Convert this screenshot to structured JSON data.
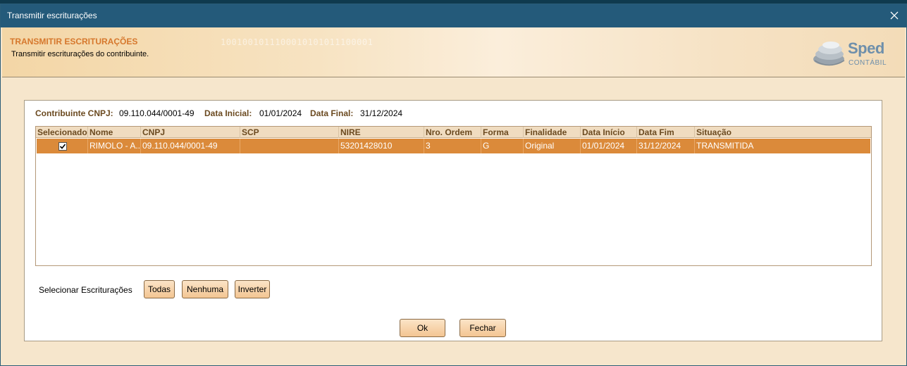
{
  "window": {
    "title": "Transmitir escriturações"
  },
  "banner": {
    "heading": "TRANSMITIR ESCRITURAÇÕES",
    "subheading": "Transmitir escriturações do contribuinte.",
    "binary_text": "1001001011100010101011100001",
    "logo": {
      "name": "Sped",
      "sub": "CONTÁBIL"
    }
  },
  "info": {
    "cnpj_label": "Contribuinte CNPJ:",
    "cnpj_value": "09.110.044/0001-49",
    "data_inicial_label": "Data Inicial:",
    "data_inicial_value": "01/01/2024",
    "data_final_label": "Data Final:",
    "data_final_value": "31/12/2024"
  },
  "table": {
    "columns": [
      "Selecionado",
      "Nome",
      "CNPJ",
      "SCP",
      "NIRE",
      "Nro. Ordem",
      "Forma",
      "Finalidade",
      "Data Início",
      "Data Fim",
      "Situação"
    ],
    "rows": [
      {
        "selected": true,
        "nome": "RIMOLO - A...",
        "cnpj": "09.110.044/0001-49",
        "scp": "",
        "nire": "53201428010",
        "nro_ordem": "3",
        "forma": "G",
        "finalidade": "Original",
        "data_inicio": "01/01/2024",
        "data_fim": "31/12/2024",
        "situacao": "TRANSMITIDA"
      }
    ]
  },
  "selection": {
    "label": "Selecionar Escriturações",
    "todas": "Todas",
    "nenhuma": "Nenhuma",
    "inverter": "Inverter"
  },
  "actions": {
    "ok": "Ok",
    "fechar": "Fechar"
  },
  "colors": {
    "titlebar": "#245a7a",
    "selected_row": "#db8a3a",
    "heading": "#d6782d",
    "label": "#6b4a20"
  }
}
